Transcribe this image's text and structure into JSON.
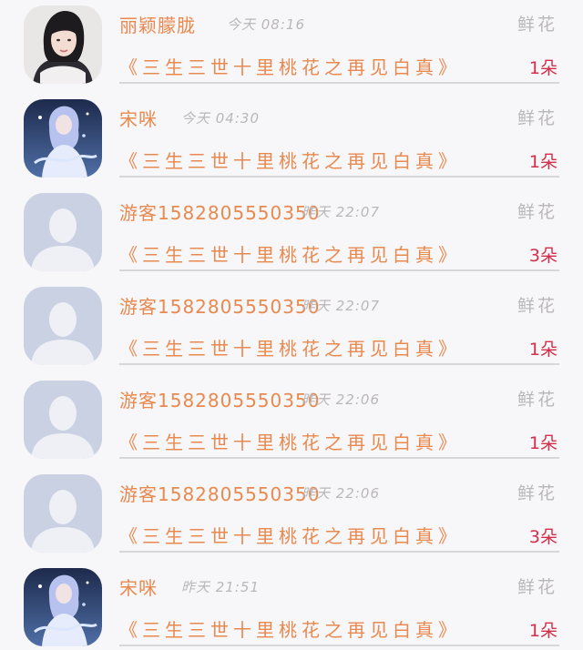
{
  "items": [
    {
      "avatar": "user-photo",
      "name": "丽颖朦胧",
      "time": "今天 08:16",
      "gift": "鲜花",
      "title": "《三生三世十里桃花之再见白真》",
      "count": "1朵"
    },
    {
      "avatar": "anime",
      "name": "宋咪",
      "time": "今天 04:30",
      "gift": "鲜花",
      "title": "《三生三世十里桃花之再见白真》",
      "count": "1朵"
    },
    {
      "avatar": "default",
      "name": "游客1582805550350",
      "time": "昨天 22:07",
      "gift": "鲜花",
      "title": "《三生三世十里桃花之再见白真》",
      "count": "3朵"
    },
    {
      "avatar": "default",
      "name": "游客1582805550350",
      "time": "昨天 22:07",
      "gift": "鲜花",
      "title": "《三生三世十里桃花之再见白真》",
      "count": "1朵"
    },
    {
      "avatar": "default",
      "name": "游客1582805550350",
      "time": "昨天 22:06",
      "gift": "鲜花",
      "title": "《三生三世十里桃花之再见白真》",
      "count": "1朵"
    },
    {
      "avatar": "default",
      "name": "游客1582805550350",
      "time": "昨天 22:06",
      "gift": "鲜花",
      "title": "《三生三世十里桃花之再见白真》",
      "count": "3朵"
    },
    {
      "avatar": "anime",
      "name": "宋咪",
      "time": "昨天 21:51",
      "gift": "鲜花",
      "title": "《三生三世十里桃花之再见白真》",
      "count": "1朵"
    }
  ],
  "colors": {
    "name": "#e8894f",
    "count": "#d42e4b",
    "muted": "#b9b7bb",
    "background": "#f7f6f8"
  }
}
